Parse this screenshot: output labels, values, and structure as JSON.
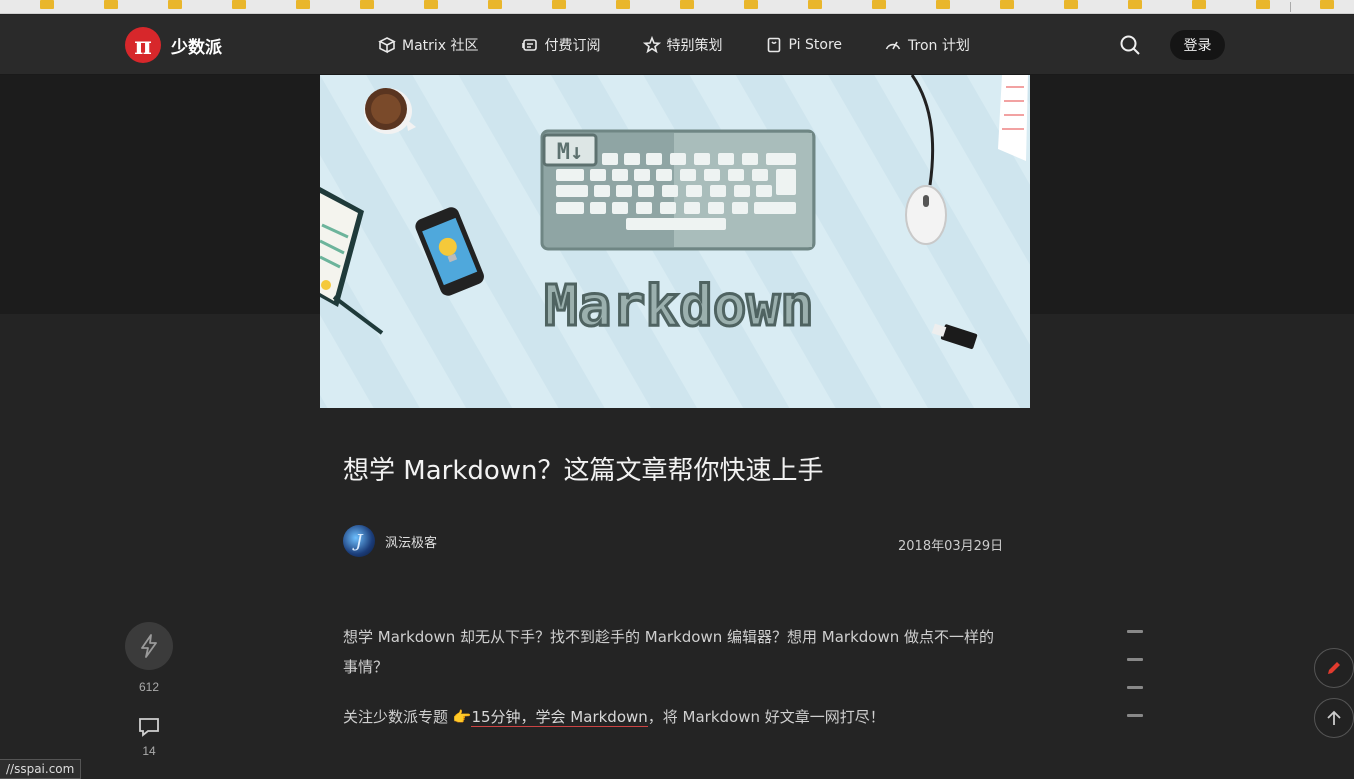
{
  "site": {
    "logo_glyph": "π",
    "name": "少数派"
  },
  "nav": {
    "items": [
      {
        "label": "Matrix 社区",
        "icon": "cube-icon"
      },
      {
        "label": "付费订阅",
        "icon": "subscription-icon"
      },
      {
        "label": "特别策划",
        "icon": "star-icon"
      },
      {
        "label": "Pi Store",
        "icon": "bag-icon"
      },
      {
        "label": "Tron 计划",
        "icon": "gauge-icon"
      }
    ],
    "login_label": "登录"
  },
  "hero": {
    "text": "Markdown",
    "badge": "M↓"
  },
  "article": {
    "title": "想学 Markdown？这篇文章帮你快速上手",
    "author": {
      "name": "沨沄极客",
      "avatar_glyph": "J"
    },
    "date": "2018年03月29日",
    "paragraph1": "想学 Markdown 却无从下手？找不到趁手的 Markdown 编辑器？想用 Markdown 做点不一样的事情？",
    "paragraph2_prefix": "关注少数派专题 👉",
    "paragraph2_link": "15分钟，学会 Markdown",
    "paragraph2_suffix": "，将 Markdown 好文章一网打尽！"
  },
  "actions": {
    "like_count": "612",
    "comment_count": "14"
  },
  "status_bar": {
    "url": "//sspai.com"
  },
  "colors": {
    "brand": "#d7272b",
    "background": "#242424",
    "navbar": "#2a2a2a"
  }
}
